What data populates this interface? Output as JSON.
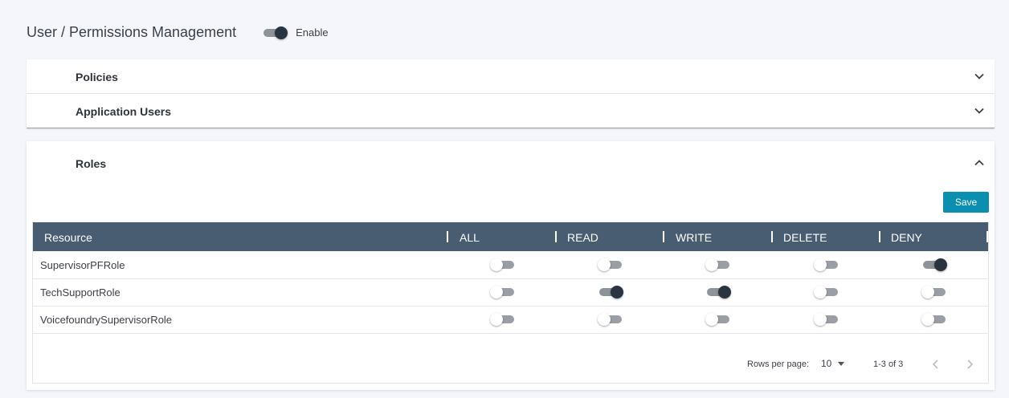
{
  "header": {
    "title": "User / Permissions Management",
    "enable_label": "Enable",
    "enable_on": true
  },
  "panels": {
    "policies": {
      "title": "Policies",
      "expanded": false
    },
    "users": {
      "title": "Application Users",
      "expanded": false
    },
    "roles": {
      "title": "Roles",
      "expanded": true
    }
  },
  "roles_table": {
    "save_label": "Save",
    "columns": [
      "Resource",
      "ALL",
      "READ",
      "WRITE",
      "DELETE",
      "DENY"
    ],
    "rows": [
      {
        "name": "SupervisorPFRole",
        "all": false,
        "read": false,
        "write": false,
        "delete": false,
        "deny": true
      },
      {
        "name": "TechSupportRole",
        "all": false,
        "read": true,
        "write": true,
        "delete": false,
        "deny": false
      },
      {
        "name": "VoicefoundrySupervisorRole",
        "all": false,
        "read": false,
        "write": false,
        "delete": false,
        "deny": false
      }
    ]
  },
  "pagination": {
    "rows_per_page_label": "Rows per page:",
    "rows_per_page": "10",
    "range": "1-3 of 3"
  },
  "icons": {
    "expand": "chevron-down-icon",
    "collapse": "chevron-up-icon",
    "prev": "chevron-left-icon",
    "next": "chevron-right-icon"
  },
  "colors": {
    "header_bg": "#485c72",
    "save_button": "#0a8fb0",
    "toggle_on_knob": "#2a3340"
  }
}
